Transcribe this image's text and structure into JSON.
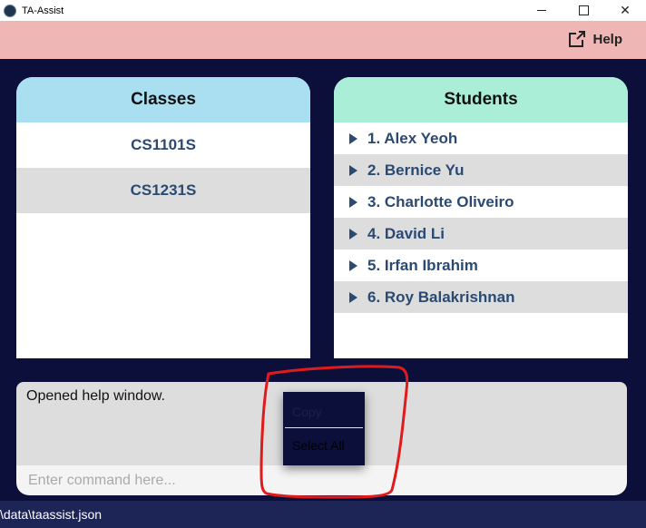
{
  "window": {
    "title": "TA-Assist",
    "minimize": "–",
    "maximize": "□",
    "close": "✕"
  },
  "menu": {
    "help_label": "Help",
    "help_icon": "external-link-icon"
  },
  "classes": {
    "header": "Classes",
    "items": [
      "CS1101S",
      "CS1231S"
    ]
  },
  "students": {
    "header": "Students",
    "items": [
      "1. Alex Yeoh",
      "2. Bernice Yu",
      "3. Charlotte Oliveiro",
      "4. David Li",
      "5. Irfan Ibrahim",
      "6. Roy Balakrishnan"
    ]
  },
  "result": {
    "text": "Opened help window."
  },
  "command": {
    "placeholder": "Enter command here..."
  },
  "context_menu": {
    "copy_label": "Copy",
    "select_all_label": "Select All"
  },
  "status": {
    "path": "\\data\\taassist.json"
  },
  "colors": {
    "background": "#0b0f3a",
    "menubar": "#eeb7b6",
    "classes_header": "#a9dff0",
    "students_header": "#aaeed7",
    "list_text": "#2a4a72",
    "annotation": "#e01b1b"
  }
}
